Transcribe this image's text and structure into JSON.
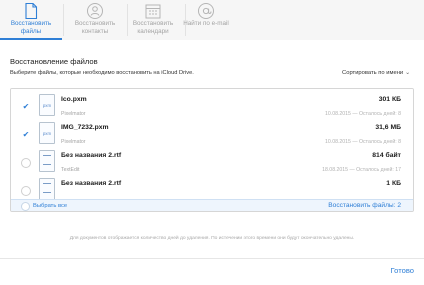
{
  "toolbar": {
    "tabs": [
      {
        "label": "Восстановить файлы",
        "icon": "document-icon"
      },
      {
        "label": "Восстановить контакты",
        "icon": "contacts-icon"
      },
      {
        "label": "Восстановить календари",
        "icon": "calendar-icon"
      },
      {
        "label": "Найти по e-mail",
        "icon": "at-sign-icon"
      }
    ]
  },
  "main": {
    "title": "Восстановление файлов",
    "subtitle": "Выберите файлы, которые необходимо восстановить на iCloud Drive.",
    "sort_label": "Сортировать по имени"
  },
  "files": [
    {
      "name": "Ico.pxm",
      "app": "Pixelmator",
      "size": "301 КБ",
      "meta": "10.08.2015 — Осталось дней: 8",
      "checked": true,
      "type": "pxm"
    },
    {
      "name": "IMG_7232.pxm",
      "app": "Pixelmator",
      "size": "31,6 МБ",
      "meta": "10.08.2015 — Осталось дней: 8",
      "checked": true,
      "type": "pxm"
    },
    {
      "name": "Без названия 2.rtf",
      "app": "TextEdit",
      "size": "814 байт",
      "meta": "18.08.2015 — Осталось дней: 17",
      "checked": false,
      "type": "rtf"
    },
    {
      "name": "Без названия 2.rtf",
      "app": "",
      "size": "1 КБ",
      "meta": "",
      "checked": false,
      "type": "rtf"
    }
  ],
  "footer": {
    "select_all": "Выбрать все",
    "restore": "Восстановить файлы: 2"
  },
  "note": "Для документов отображается количество дней до удаления. По истечении этого времени они будут окончательно удалены.",
  "done": "Готово",
  "colors": {
    "accent": "#2f7fd6",
    "muted": "#a3a3a3"
  }
}
